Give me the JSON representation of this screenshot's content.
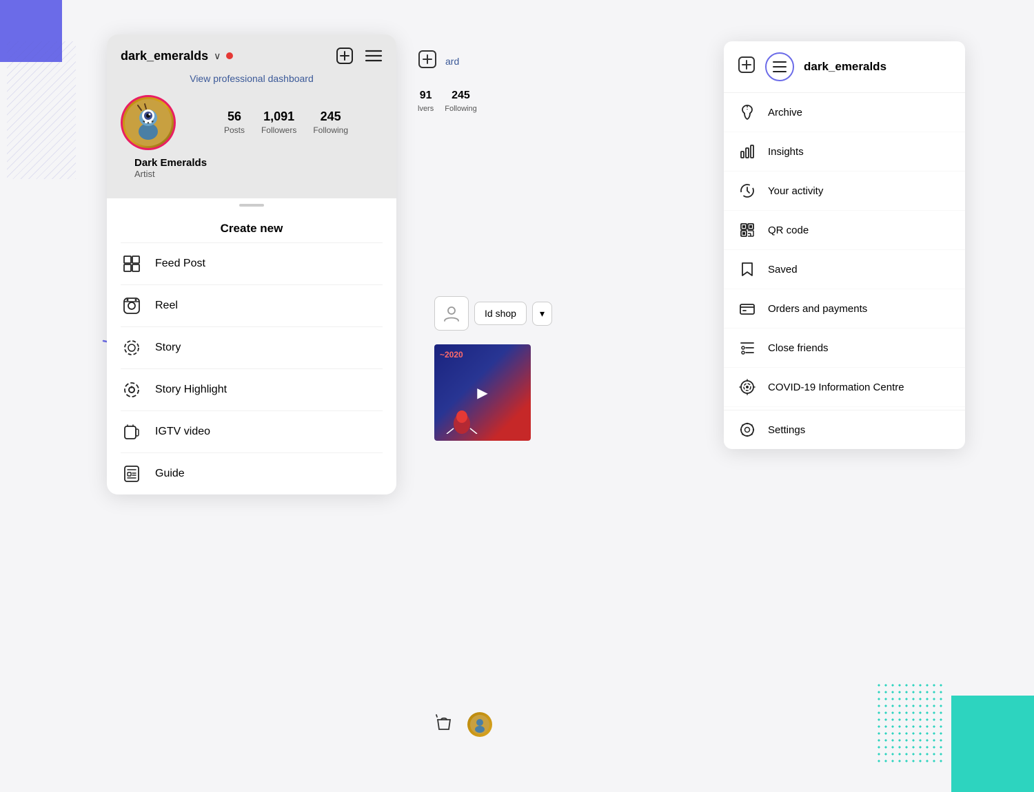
{
  "background": {
    "purple_rect": "top-left purple rectangle",
    "teal_rect": "bottom-right teal rectangle",
    "diagonal_lines": "diagonal line pattern"
  },
  "left_panel": {
    "username": "dark_emeralds",
    "status_dot": "red",
    "dashboard_link": "View professional dashboard",
    "stats": {
      "posts": {
        "value": "56",
        "label": "Posts"
      },
      "followers": {
        "value": "1,091",
        "label": "Followers"
      },
      "following": {
        "value": "245",
        "label": "Following"
      }
    },
    "display_name": "Dark Emeralds",
    "display_title": "Artist",
    "create_title": "Create new",
    "menu_items": [
      {
        "id": "feed-post",
        "label": "Feed Post"
      },
      {
        "id": "reel",
        "label": "Reel"
      },
      {
        "id": "story",
        "label": "Story"
      },
      {
        "id": "story-highlight",
        "label": "Story Highlight"
      },
      {
        "id": "igtv-video",
        "label": "IGTV video"
      },
      {
        "id": "guide",
        "label": "Guide"
      }
    ]
  },
  "right_panel": {
    "username": "dark_emeralds",
    "menu_items": [
      {
        "id": "archive",
        "label": "Archive"
      },
      {
        "id": "insights",
        "label": "Insights"
      },
      {
        "id": "your-activity",
        "label": "Your activity"
      },
      {
        "id": "qr-code",
        "label": "QR code"
      },
      {
        "id": "saved",
        "label": "Saved"
      },
      {
        "id": "orders-payments",
        "label": "Orders and payments"
      },
      {
        "id": "close-friends",
        "label": "Close friends"
      },
      {
        "id": "covid-info",
        "label": "COVID-19 Information Centre"
      },
      {
        "id": "settings",
        "label": "Settings"
      }
    ]
  },
  "partial_profile": {
    "followers_count": "91",
    "following_count": "245",
    "following_label": "Following",
    "dashboard_link": "ard",
    "shop_label": "Id shop"
  }
}
